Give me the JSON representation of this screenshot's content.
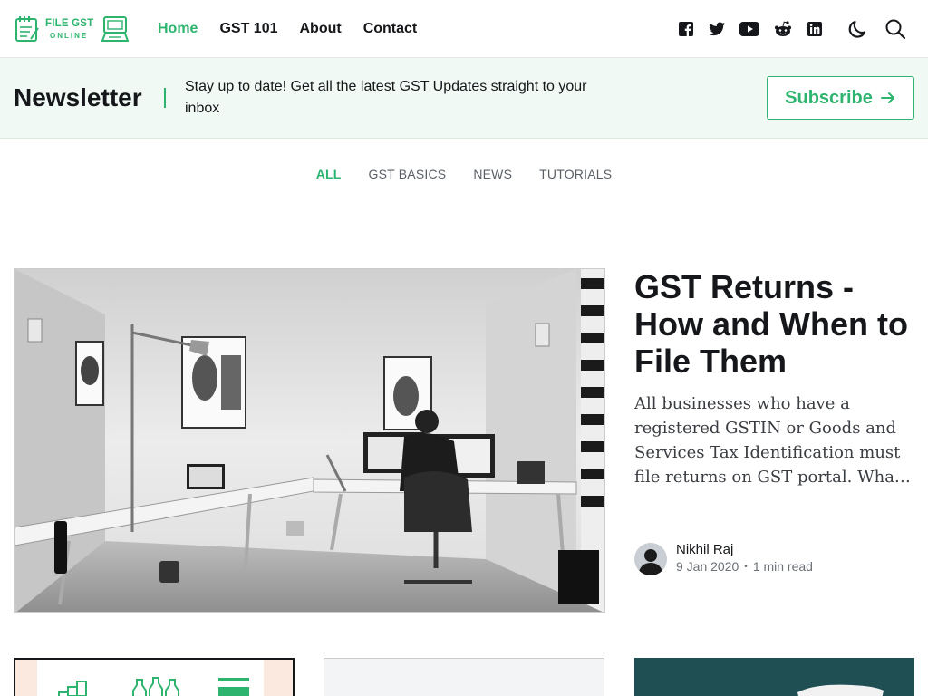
{
  "header": {
    "logo_line1": "FILE GST",
    "logo_line2": "ONLINE",
    "nav": [
      "Home",
      "GST 101",
      "About",
      "Contact"
    ],
    "social_icons": [
      "facebook-icon",
      "twitter-icon",
      "youtube-icon",
      "reddit-icon",
      "linkedin-icon"
    ],
    "accent_color": "#2db46e"
  },
  "newsletter": {
    "title": "Newsletter",
    "description": "Stay up to date! Get all the latest GST Updates straight to your inbox",
    "button_label": "Subscribe"
  },
  "tabs": [
    "ALL",
    "GST BASICS",
    "NEWS",
    "TUTORIALS"
  ],
  "featured": {
    "title": "GST Returns - How and When to File Them",
    "excerpt": "All businesses who have a registered GSTIN or Goods and Services Tax Identification must file returns on GST portal. What is...",
    "author": "Nikhil Raj",
    "date": "9 Jan 2020",
    "read_time": "1 min read"
  }
}
